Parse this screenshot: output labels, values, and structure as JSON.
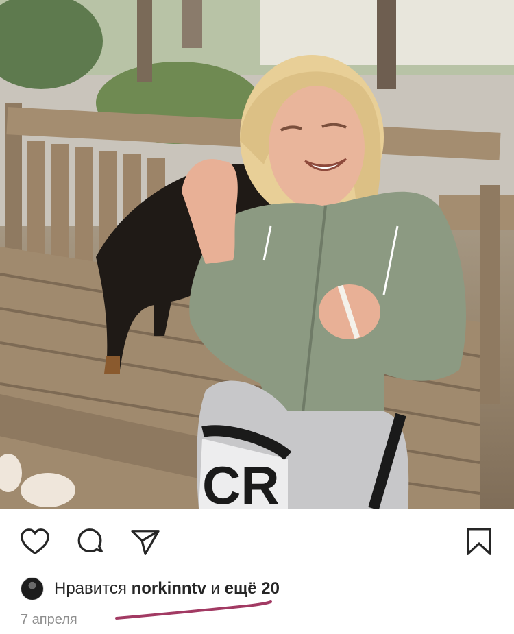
{
  "post": {
    "likes": {
      "prefix": "Нравится ",
      "user": "norkinntv",
      "joiner": " и ",
      "more": "ещё 20"
    },
    "date": "7 апреля"
  },
  "icons": {
    "like": "heart-icon",
    "comment": "comment-icon",
    "share": "send-icon",
    "save": "bookmark-icon"
  },
  "colors": {
    "icon": "#262626",
    "muted": "#8e8e8e",
    "annotation": "#a23a63"
  }
}
